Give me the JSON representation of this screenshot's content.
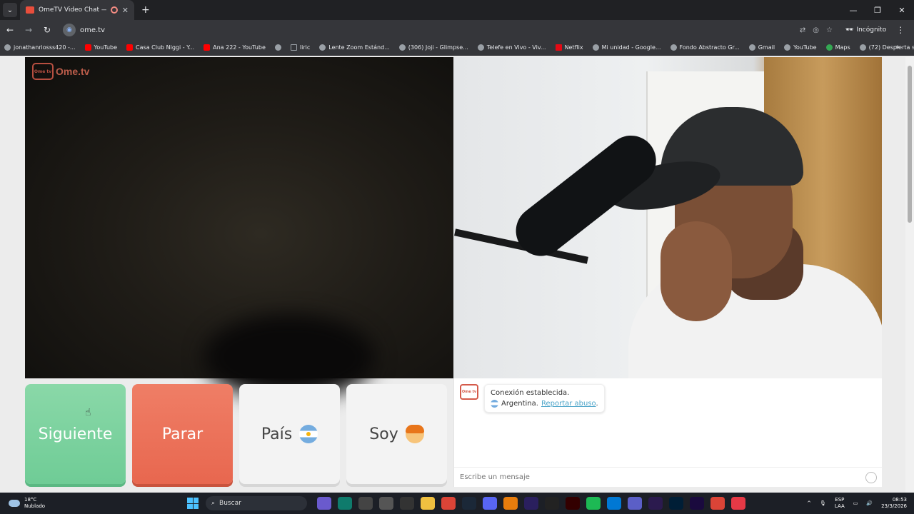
{
  "browser": {
    "tab_title": "OmeTV Video Chat — Om",
    "url": "ome.tv",
    "incognito_label": "Incógnito",
    "bookmarks": [
      {
        "label": "jonathanriosss420 -...",
        "icon": "globe-icon"
      },
      {
        "label": "YouTube",
        "icon": "youtube-icon"
      },
      {
        "label": "Casa Club Niggi - Y...",
        "icon": "youtube-icon"
      },
      {
        "label": "Ana 222 - YouTube",
        "icon": "youtube-icon"
      },
      {
        "label": "",
        "icon": "globe-icon"
      },
      {
        "label": "liric",
        "icon": "folder-icon"
      },
      {
        "label": "Lente Zoom Estánd...",
        "icon": "globe-icon"
      },
      {
        "label": "(306) Joji - Glimpse...",
        "icon": "globe-icon"
      },
      {
        "label": "Telefe en Vivo - Viv...",
        "icon": "globe-icon"
      },
      {
        "label": "Netflix",
        "icon": "netflix-icon"
      },
      {
        "label": "Mi unidad - Google...",
        "icon": "globe-icon"
      },
      {
        "label": "Fondo Abstracto Gr...",
        "icon": "globe-icon"
      },
      {
        "label": "Gmail",
        "icon": "globe-icon"
      },
      {
        "label": "YouTube",
        "icon": "globe-icon"
      },
      {
        "label": "Maps",
        "icon": "maps-icon"
      },
      {
        "label": "(72) Despierta solda...",
        "icon": "globe-icon"
      }
    ]
  },
  "ome": {
    "logo_small": "Ome tv",
    "logo_text": "Ome.tv",
    "buttons": {
      "next": "Siguiente",
      "stop": "Parar",
      "country": "País",
      "gender": "Soy"
    },
    "chat": {
      "status": "Conexión establecida.",
      "country": "Argentina.",
      "report": "Reportar abuso",
      "report_suffix": ".",
      "input_placeholder": "Escribe un mensaje"
    }
  },
  "taskbar": {
    "temperature": "18°C",
    "weather": "Nublado",
    "search_placeholder": "Buscar",
    "lang_top": "ESP",
    "lang_bottom": "LAA",
    "time": "08:53",
    "date": "23/3/2026"
  },
  "colors": {
    "next": "#7fd3a1",
    "stop": "#ea6f57",
    "accent": "#4aa3c8"
  }
}
